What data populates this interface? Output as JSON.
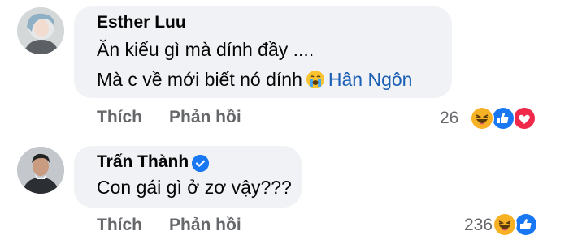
{
  "comments": [
    {
      "author": "Esther Luu",
      "lines": [
        "Ăn kiểu gì mà dính đầy ....",
        "Mà c về mới biết nó dính"
      ],
      "mention": "Hân Ngôn",
      "emoji": "crying-face-icon",
      "actions": {
        "like": "Thích",
        "reply": "Phản hồi"
      },
      "reaction_count": "26",
      "reactions": [
        "haha-icon",
        "like-icon",
        "love-icon"
      ]
    },
    {
      "author": "Trấn Thành",
      "verified": true,
      "lines": [
        "Con gái gì ở zơ vậy???"
      ],
      "actions": {
        "like": "Thích",
        "reply": "Phản hồi"
      },
      "reaction_count": "236",
      "reactions": [
        "haha-icon",
        "like-icon"
      ]
    }
  ],
  "colors": {
    "bubble": "#f0f2f5",
    "secondary_text": "#65676b",
    "mention": "#1a5fb4",
    "verified_badge": "#1877f2",
    "like_reaction": "#1877f2",
    "love_reaction": "#f02849",
    "haha_reaction": "#f7b125"
  }
}
